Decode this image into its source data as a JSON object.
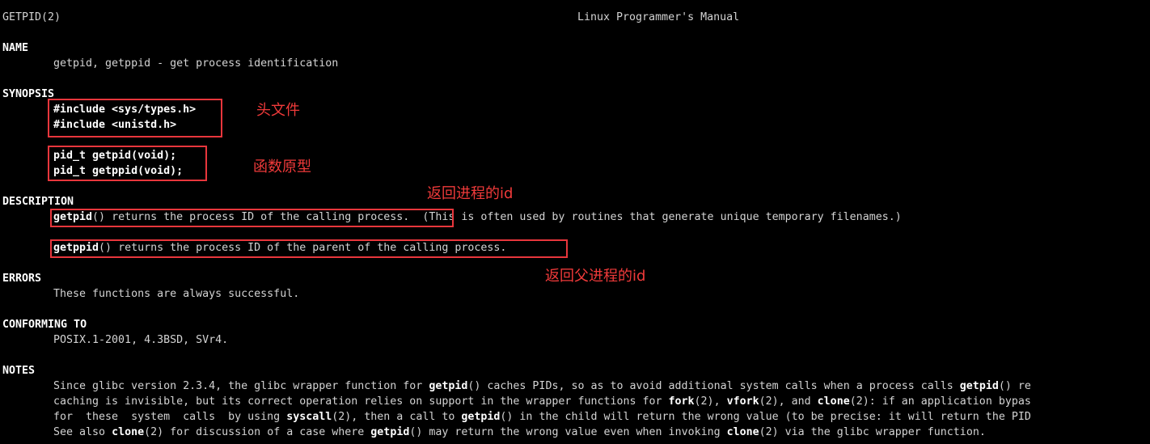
{
  "header": {
    "left": "GETPID(2)",
    "center": "Linux Programmer's Manual"
  },
  "sections": {
    "name": {
      "heading": "NAME",
      "text": "getpid, getppid - get process identification"
    },
    "synopsis": {
      "heading": "SYNOPSIS",
      "include1": "#include <sys/types.h>",
      "include2": "#include <unistd.h>",
      "proto1": "pid_t getpid(void);",
      "proto2": "pid_t getppid(void);"
    },
    "description": {
      "heading": "DESCRIPTION",
      "line1_fn": "getpid",
      "line1_rest": "() returns the process ID of the calling process.",
      "line1_extra": "  (This is often used by routines that generate unique temporary filenames.)",
      "line2_fn": "getppid",
      "line2_rest": "() returns the process ID of the parent of the calling process."
    },
    "errors": {
      "heading": "ERRORS",
      "text": "These functions are always successful."
    },
    "conforming": {
      "heading": "CONFORMING TO",
      "text": "POSIX.1-2001, 4.3BSD, SVr4."
    },
    "notes": {
      "heading": "NOTES",
      "l1": {
        "a": "Since glibc version 2.3.4, the glibc wrapper function for ",
        "b": "getpid",
        "c": "() caches PIDs, so as to avoid additional system calls when a process calls ",
        "d": "getpid",
        "e": "() re"
      },
      "l2": {
        "a": "caching is invisible, but its correct operation relies on support in the wrapper functions for ",
        "b": "fork",
        "c": "(2), ",
        "d": "vfork",
        "e": "(2), and ",
        "f": "clone",
        "g": "(2): if an application bypas"
      },
      "l3": {
        "a": "for  these  system  calls  by using ",
        "b": "syscall",
        "c": "(2), then a call to ",
        "d": "getpid",
        "e": "() in the child will return the wrong value (to be precise: it will return the PID"
      },
      "l4": {
        "a": "See also ",
        "b": "clone",
        "c": "(2) for discussion of a case where ",
        "d": "getpid",
        "e": "() may return the wrong value even when invoking ",
        "f": "clone",
        "g": "(2) via the glibc wrapper function."
      }
    }
  },
  "annotations": {
    "header_file": "头文件",
    "prototype": "函数原型",
    "returns_pid": "返回进程的id",
    "returns_ppid": "返回父进程的id"
  },
  "colors": {
    "background": "#000000",
    "text": "#d3d3d3",
    "bold": "#ffffff",
    "annotation": "#e8363c"
  }
}
